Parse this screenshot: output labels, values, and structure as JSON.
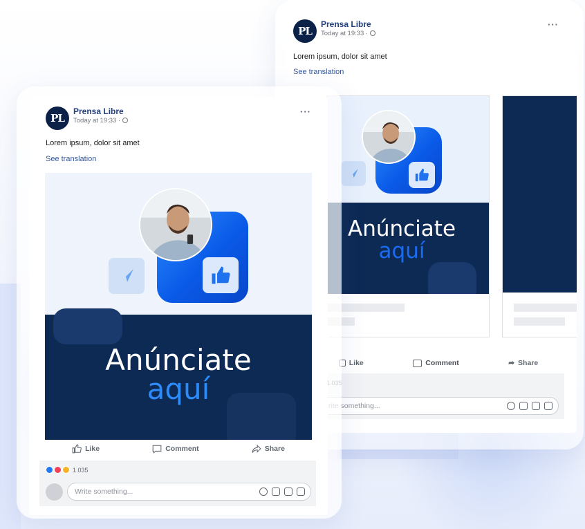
{
  "post": {
    "page_name": "Prensa Libre",
    "avatar_initials": "PL",
    "timestamp": "Today at 19:33 · ",
    "privacy_icon": "globe-icon",
    "body_text": "Lorem ipsum, dolor sit amet",
    "see_translation": "See translation",
    "more_icon": "···"
  },
  "ad": {
    "headline_line1": "Anúnciate",
    "headline_line2": "aquí"
  },
  "actions": {
    "like": "Like",
    "comment": "Comment",
    "share": "Share"
  },
  "reactions": {
    "count": "1.035"
  },
  "composer": {
    "placeholder": "Write something...",
    "placeholder_cropped": "rite something..."
  },
  "colors": {
    "brand_navy": "#0d2a55",
    "brand_blue": "#0a5ae8",
    "accent_blue": "#2d8bf9",
    "link_blue": "#385898"
  }
}
